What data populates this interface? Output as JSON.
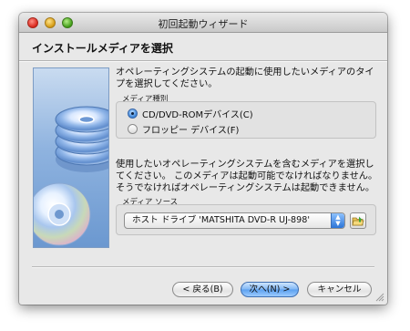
{
  "window": {
    "title": "初回起動ウィザード"
  },
  "header": {
    "title": "インストールメディアを選択"
  },
  "intro": {
    "text": "オペレーティングシステムの起動に使用したいメディアのタイプを選択してください。"
  },
  "media_type": {
    "label": "メディア種別",
    "options": [
      {
        "label": "CD/DVD-ROMデバイス(C)",
        "selected": true
      },
      {
        "label": "フロッピー デバイス(F)",
        "selected": false
      }
    ]
  },
  "description": {
    "text": "使用したいオペレーティングシステムを含むメディアを選択してください。 このメディアは起動可能でなければなりません。そうでなければオペレーティングシステムは起動できません。"
  },
  "media_source": {
    "label": "メディア ソース",
    "selected": "ホスト ドライブ 'MATSHITA DVD-R   UJ-898'"
  },
  "buttons": {
    "back": "< 戻る(B)",
    "next": "次へ(N) >",
    "cancel": "キャンセル"
  },
  "colors": {
    "accent": "#5aa0ef",
    "window_bg": "#e8e8e8"
  },
  "icons": {
    "sidebar": "cd-disc-stack-icon",
    "source_button": "folder-open-icon"
  }
}
